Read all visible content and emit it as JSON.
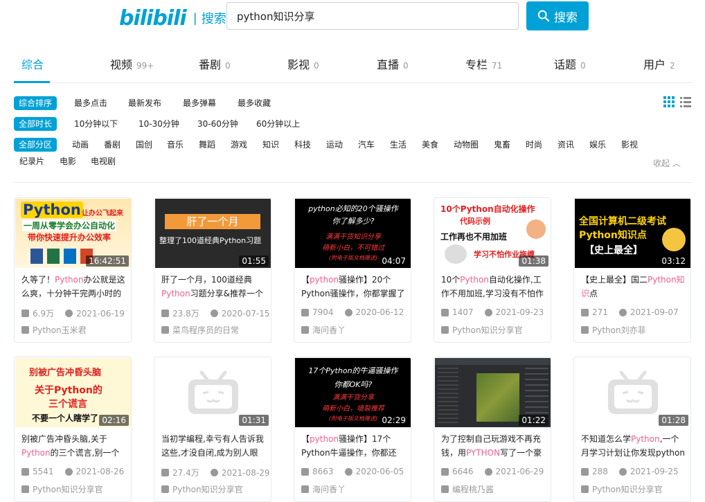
{
  "header": {
    "logo": "bilibili",
    "sep": "|",
    "search_label": "搜索",
    "query": "python知识分享",
    "search_button": "搜索"
  },
  "tabs": [
    {
      "label": "综合",
      "count": ""
    },
    {
      "label": "视频",
      "count": "99+"
    },
    {
      "label": "番剧",
      "count": "0"
    },
    {
      "label": "影视",
      "count": "0"
    },
    {
      "label": "直播",
      "count": "0"
    },
    {
      "label": "专栏",
      "count": "71"
    },
    {
      "label": "话题",
      "count": "0"
    },
    {
      "label": "用户",
      "count": "2"
    }
  ],
  "filters": {
    "sort": [
      "综合排序",
      "最多点击",
      "最新发布",
      "最多弹幕",
      "最多收藏"
    ],
    "duration": [
      "全部时长",
      "10分钟以下",
      "10-30分钟",
      "30-60分钟",
      "60分钟以上"
    ],
    "zone": [
      "全部分区",
      "动画",
      "番剧",
      "国创",
      "音乐",
      "舞蹈",
      "游戏",
      "知识",
      "科技",
      "运动",
      "汽车",
      "生活",
      "美食",
      "动物圈",
      "鬼畜",
      "时尚",
      "资讯",
      "娱乐",
      "影视",
      "纪录片",
      "电影",
      "电视剧"
    ],
    "collapse": "收起"
  },
  "colors": {
    "accent": "#00a1d6",
    "highlight": "#f25d8e",
    "muted": "#999999"
  },
  "videos": [
    {
      "duration": "16:42:51",
      "title_pre": "久等了！",
      "title_hl": "Python",
      "title_post": "办公就是这么爽，十分钟干完两小时的",
      "views": "6.9万",
      "date": "2021-06-19",
      "uploader": "Python玉米君"
    },
    {
      "duration": "01:55",
      "title_pre": "肝了一个月，100道经典",
      "title_hl": "Python",
      "title_post": "习题分享&推荐一个",
      "views": "23.8万",
      "date": "2020-07-15",
      "uploader": "菜鸟程序员的日常"
    },
    {
      "duration": "04:07",
      "title_pre": "【",
      "title_hl": "python",
      "title_post": "骚操作】20个Python骚操作，你都掌握了",
      "views": "7904",
      "date": "2020-06-12",
      "uploader": "海问香丫"
    },
    {
      "duration": "01:38",
      "title_pre": "10个",
      "title_hl": "Python",
      "title_post": "自动化操作,工作不用加班,学习没有不怕作",
      "views": "1407",
      "date": "2021-09-23",
      "uploader": "Python知识分享官"
    },
    {
      "duration": "03:12",
      "title_pre": "【史上最全】国二",
      "title_hl": "Python知识",
      "title_post": "点",
      "views": "271",
      "date": "2021-09-07",
      "uploader": "Python刘亦菲"
    },
    {
      "duration": "02:16",
      "title_pre": "别被广告冲昏头脑,关于",
      "title_hl": "Python",
      "title_post": "的三个谎言,别一个",
      "views": "5541",
      "date": "2021-08-26",
      "uploader": "Python知识分享官"
    },
    {
      "duration": "01:31",
      "title_pre": "当初学编程,幸亏有人告诉我这些,才没自闭,成为别人眼",
      "title_hl": "",
      "title_post": "",
      "views": "27.4万",
      "date": "2021-08-29",
      "uploader": "Python知识分享官"
    },
    {
      "duration": "02:29",
      "title_pre": "【",
      "title_hl": "python",
      "title_post": "骚操作】17个Python牛逼操作，你都还",
      "views": "8663",
      "date": "2020-06-05",
      "uploader": "海问香丫"
    },
    {
      "duration": "01:22",
      "title_pre": "为了控制自己玩游戏不再充钱，用",
      "title_hl": "PYTHON",
      "title_post": "写了一个豪",
      "views": "6646",
      "date": "2021-06-29",
      "uploader": "编程桃乃酱"
    },
    {
      "duration": "01:28",
      "title_pre": "不知道怎么学",
      "title_hl": "Python",
      "title_post": ",一个月学习计划让你发现python",
      "views": "288",
      "date": "2021-09-25",
      "uploader": "Python知识分享官"
    }
  ],
  "thumbs": [
    {
      "text1": "Python",
      "text2": "让办公飞起来",
      "text3": "一周从零学会办公自动化",
      "text4": "带你快速提升办公效率"
    },
    {
      "text1": "肝了一个月",
      "text2": "整理了100道经典Python习题"
    },
    {
      "text1": "python必知的20个骚操作",
      "text2": "你了解多少?",
      "text3": "满满干货知识分享",
      "text4": "萌新小白，不可错过",
      "text5": "(附电子版文档赠送)"
    },
    {
      "text1": "10个Python自动化操作",
      "text2": "代码示例",
      "text3": "工作再也不用加班",
      "text4": "学习不怕作业拖缠"
    },
    {
      "text1": "全国计算机二级考试",
      "text2": "Python知识点",
      "text3": "【史上最全】"
    },
    {
      "text1": "别被广告冲昏头脑",
      "text2": "关于Python的",
      "text3": "三个谎言",
      "text4": "不要一个人瞎学了"
    },
    {},
    {
      "text1": "17个Python的牛逼骚操作",
      "text2": "你都OK吗?",
      "text3": "满满干货分享",
      "text4": "萌新小白，墙裂推荐",
      "text5": "(附电子版文档赠送)"
    },
    {},
    {}
  ]
}
